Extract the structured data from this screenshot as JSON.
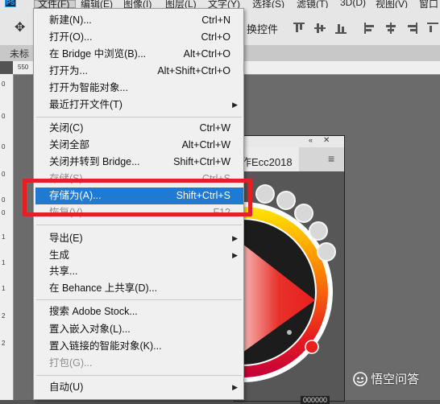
{
  "app_logo": "PS",
  "menubar": {
    "items": [
      "文件(F)",
      "编辑(E)",
      "图像(I)",
      "图层(L)",
      "文字(Y)",
      "选择(S)",
      "滤镜(T)",
      "3D(D)",
      "视图(V)",
      "窗口"
    ]
  },
  "options_bar": {
    "transform_label": "换控件"
  },
  "document_tab": {
    "title": "未标"
  },
  "ruler": {
    "h_label": "550",
    "v_labels": [
      "0",
      "0",
      "0",
      "0",
      "0",
      "0",
      "1",
      "1",
      "1",
      "2",
      "2"
    ]
  },
  "panel": {
    "title": "作Ecc2018",
    "collapse_icon": "«",
    "close_icon": "✕",
    "menu_icon": "≡",
    "footer_text": "000000"
  },
  "menu": {
    "items": [
      {
        "label": "新建(N)...",
        "shortcut": "Ctrl+N"
      },
      {
        "label": "打开(O)...",
        "shortcut": "Ctrl+O"
      },
      {
        "label": "在 Bridge 中浏览(B)...",
        "shortcut": "Alt+Ctrl+O"
      },
      {
        "label": "打开为...",
        "shortcut": "Alt+Shift+Ctrl+O"
      },
      {
        "label": "打开为智能对象...",
        "shortcut": ""
      },
      {
        "label": "最近打开文件(T)",
        "shortcut": "",
        "submenu": true
      },
      {
        "label": "关闭(C)",
        "shortcut": "Ctrl+W"
      },
      {
        "label": "关闭全部",
        "shortcut": "Alt+Ctrl+W"
      },
      {
        "label": "关闭并转到 Bridge...",
        "shortcut": "Shift+Ctrl+W"
      },
      {
        "label": "存储(S)",
        "shortcut": "Ctrl+S",
        "disabled": true
      },
      {
        "label": "存储为(A)...",
        "shortcut": "Shift+Ctrl+S",
        "highlighted": true
      },
      {
        "label": "恢复(V)",
        "shortcut": "F12",
        "disabled": true
      },
      {
        "label": "导出(E)",
        "shortcut": "",
        "submenu": true
      },
      {
        "label": "生成",
        "shortcut": "",
        "submenu": true
      },
      {
        "label": "共享...",
        "shortcut": ""
      },
      {
        "label": "在 Behance 上共享(D)...",
        "shortcut": ""
      },
      {
        "label": "搜索 Adobe Stock...",
        "shortcut": ""
      },
      {
        "label": "置入嵌入对象(L)...",
        "shortcut": ""
      },
      {
        "label": "置入链接的智能对象(K)...",
        "shortcut": ""
      },
      {
        "label": "打包(G)...",
        "shortcut": "",
        "disabled": true
      },
      {
        "label": "自动(U)",
        "shortcut": "",
        "submenu": true
      }
    ]
  },
  "watermark": "悟空问答",
  "colors": {
    "menu_highlight": "#1e7ad2",
    "annotation_red": "#e41f26",
    "wheel_red": "#e8201e",
    "wheel_orange": "#ff8a00",
    "wheel_yellow": "#ffe600"
  }
}
